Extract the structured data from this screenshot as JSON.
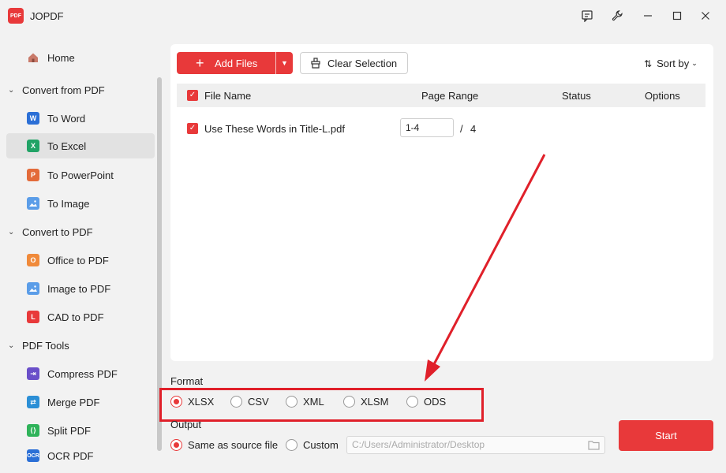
{
  "app": {
    "title": "JOPDF",
    "logo_text": "PDF"
  },
  "sidebar": {
    "home": "Home",
    "groups": [
      {
        "label": "Convert from PDF",
        "items": [
          "To Word",
          "To Excel",
          "To PowerPoint",
          "To Image"
        ]
      },
      {
        "label": "Convert to PDF",
        "items": [
          "Office to PDF",
          "Image to PDF",
          "CAD to PDF"
        ]
      },
      {
        "label": "PDF Tools",
        "items": [
          "Compress PDF",
          "Merge PDF",
          "Split PDF",
          "OCR PDF"
        ]
      }
    ],
    "active": "To Excel"
  },
  "toolbar": {
    "add_files": "Add Files",
    "clear_selection": "Clear Selection",
    "sort_by": "Sort by"
  },
  "table": {
    "headers": {
      "file_name": "File Name",
      "page_range": "Page Range",
      "status": "Status",
      "options": "Options"
    },
    "rows": [
      {
        "file_name": "Use These Words in Title-L.pdf",
        "page_range": "1-4",
        "separator": "/",
        "total_pages": "4",
        "checked": true
      }
    ]
  },
  "format": {
    "label": "Format",
    "options": [
      "XLSX",
      "CSV",
      "XML",
      "XLSM",
      "ODS"
    ],
    "selected": "XLSX"
  },
  "output": {
    "label": "Output",
    "same_as_source": "Same as source file",
    "custom": "Custom",
    "path_placeholder": "C:/Users/Administrator/Desktop",
    "selected": "Same as source file"
  },
  "start_button": "Start",
  "colors": {
    "accent": "#e8393a",
    "highlight": "#e0202a"
  }
}
